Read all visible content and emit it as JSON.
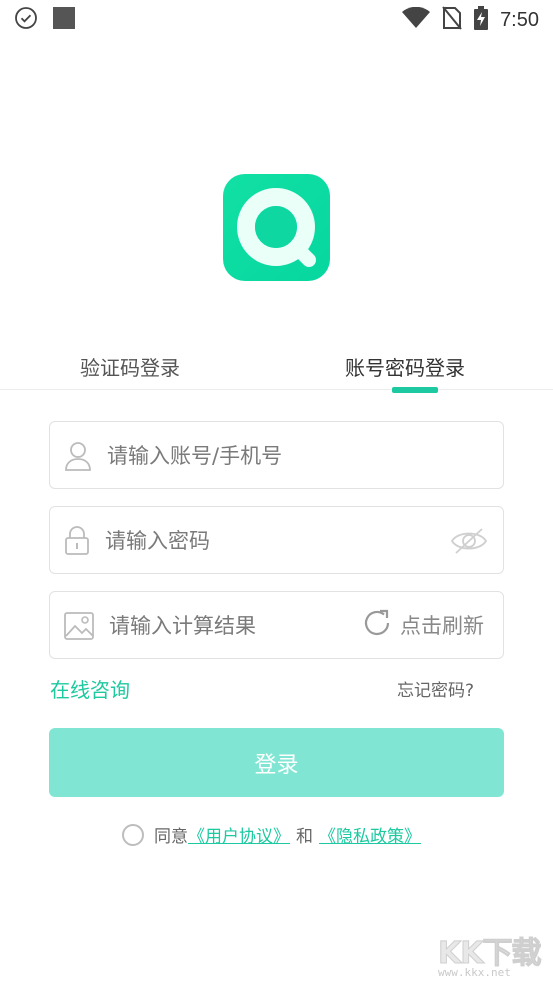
{
  "status_bar": {
    "time": "7:50",
    "icons": [
      "check-circle-icon",
      "square-notification-icon",
      "wifi-icon",
      "no-sim-icon",
      "battery-charging-icon"
    ]
  },
  "app": {
    "logo_icon": "app-logo-icon",
    "accent_color": "#1cc9a0"
  },
  "tabs": [
    {
      "label": "验证码登录",
      "active": false
    },
    {
      "label": "账号密码登录",
      "active": true
    }
  ],
  "form": {
    "account": {
      "placeholder": "请输入账号/手机号",
      "value": "",
      "icon": "user-icon"
    },
    "password": {
      "placeholder": "请输入密码",
      "value": "",
      "icon": "lock-icon",
      "toggle_icon": "eye-off-icon"
    },
    "captcha": {
      "placeholder": "请输入计算结果",
      "value": "",
      "icon": "image-icon",
      "refresh_label": "点击刷新",
      "refresh_icon": "refresh-icon"
    }
  },
  "links": {
    "consult": "在线咨询",
    "forgot": "忘记密码?"
  },
  "login_button": "登录",
  "agreement": {
    "prefix": "同意",
    "user_agreement": "《用户协议》",
    "and": "和",
    "privacy_policy": "《隐私政策》"
  },
  "watermark": {
    "logo": "KK下载",
    "url": "www.kkx.net"
  }
}
